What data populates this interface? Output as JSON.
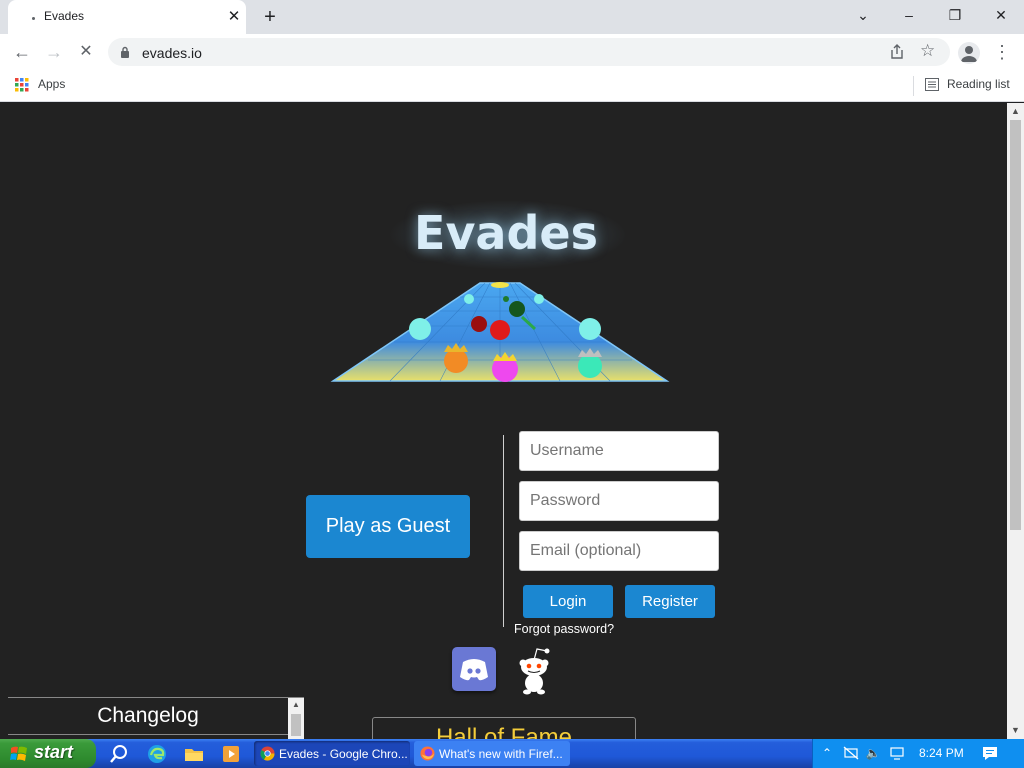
{
  "browser": {
    "tab_title": "Evades",
    "tab_close": "✕",
    "new_tab": "+",
    "tab_search": "⌄",
    "minimize": "–",
    "maximize": "❐",
    "close": "✕",
    "back": "←",
    "forward": "→",
    "stop": "✕",
    "url": "evades.io",
    "star": "☆",
    "menu": "⋮",
    "bookmarks": {
      "apps_label": "Apps",
      "reading_list_label": "Reading list"
    }
  },
  "page": {
    "title": "Evades",
    "guest_button": "Play as Guest",
    "login_form": {
      "username_placeholder": "Username",
      "password_placeholder": "Password",
      "email_placeholder": "Email (optional)",
      "login_label": "Login",
      "register_label": "Register",
      "forgot_label": "Forgot password?"
    },
    "social": [
      "discord-icon",
      "reddit-icon"
    ],
    "changelog_title": "Changelog",
    "hall_of_fame_title": "Hall of Fame",
    "colors": {
      "background": "#222222",
      "button_blue": "#1b87d1",
      "title": "#d8ecf8",
      "hall_of_fame_gold": "#f4cd3a"
    }
  },
  "taskbar": {
    "start_label": "start",
    "tasks": [
      {
        "label": "Evades - Google Chro...",
        "icon": "chrome-icon"
      },
      {
        "label": "What's new with Firef...",
        "icon": "firefox-icon"
      }
    ],
    "tray": {
      "chevron": "⌃",
      "volume": "🔈",
      "time": "8:24 PM"
    }
  }
}
